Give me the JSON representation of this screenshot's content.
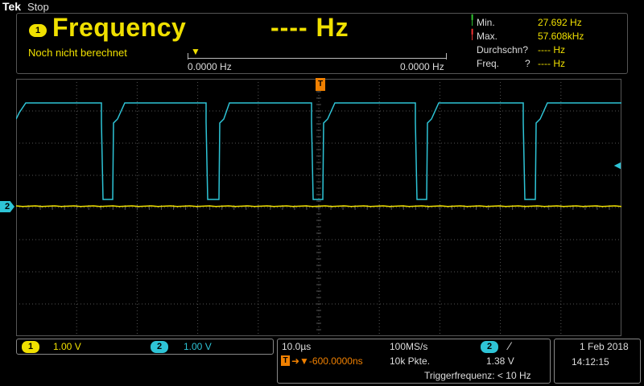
{
  "header": {
    "brand": "Tek",
    "run_state": "Stop"
  },
  "measurement": {
    "channel_badge": "1",
    "title": "Frequency",
    "value": "---- Hz",
    "note": "Noch nicht berechnet",
    "histogram": {
      "left_label": "0.0000 Hz",
      "right_label": "0.0000 Hz",
      "marker": "▼"
    },
    "stats": {
      "min_label": "Min.",
      "min_value": "27.692 Hz",
      "max_label": "Max.",
      "max_value": "57.608kHz",
      "mean_label": "Durchschn?",
      "mean_value": "---- Hz",
      "freq_label": "Freq.",
      "freq_q": "?",
      "freq_value": "---- Hz"
    }
  },
  "screen": {
    "ch2_marker": "2",
    "trigger_top_marker": "T",
    "trigger_level_marker": "◄"
  },
  "vertical": {
    "ch1": {
      "badge": "1",
      "scale": "1.00 V"
    },
    "ch2": {
      "badge": "2",
      "scale": "1.00 V"
    }
  },
  "timebase": {
    "scale": "10.0µs",
    "sample_rate": "100MS/s",
    "trigger_badge": "2",
    "trigger_slope": "⁄",
    "position_prefix": "T",
    "position": "➜▼-600.0000ns",
    "record_length": "10k Pkte.",
    "trigger_level": "1.38 V",
    "trigger_freq": "Triggerfrequenz: < 10 Hz"
  },
  "datetime": {
    "date": "1 Feb  2018",
    "time": "14:12:15"
  },
  "colors": {
    "ch1": "#f0e000",
    "ch2": "#2ec4d6",
    "trigger": "#f08000",
    "grid": "#555555"
  },
  "trace_pattern": {
    "pulse_high_V": 2.6,
    "pulse_low_V": 0.2,
    "ch1_level_V": 0.0
  }
}
